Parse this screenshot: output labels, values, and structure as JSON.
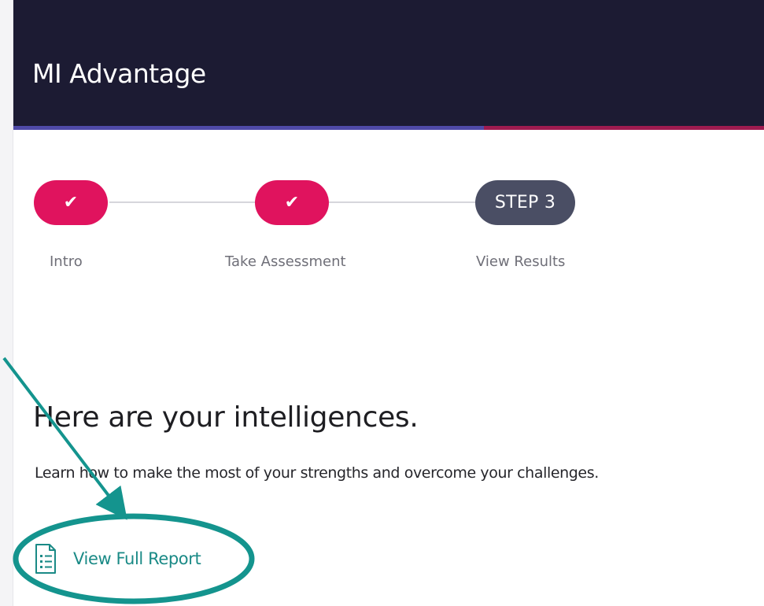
{
  "app": {
    "title": "MI Advantage"
  },
  "stepper": {
    "steps": [
      {
        "label": "Intro",
        "state": "complete",
        "indicator": "check-icon"
      },
      {
        "label": "Take Assessment",
        "state": "complete",
        "indicator": "check-icon"
      },
      {
        "label": "View Results",
        "state": "current",
        "badge": "STEP 3"
      }
    ]
  },
  "content": {
    "headline": "Here are your intelligences.",
    "subtitle": "Learn how to make the most of your strengths and overcome your challenges.",
    "report_link": {
      "label": "View Full Report",
      "icon": "report-document-icon"
    }
  },
  "annotation": {
    "type": "arrow-and-circle-highlight",
    "target": "View Full Report"
  },
  "colors": {
    "header_bg": "#1c1b33",
    "accent_pink": "#e0135e",
    "current_step": "#4a4e64",
    "link_teal": "#1a8a86",
    "annotation_teal": "#14948e",
    "underline_purple": "#4f4aa8",
    "underline_magenta": "#9e1b50"
  }
}
